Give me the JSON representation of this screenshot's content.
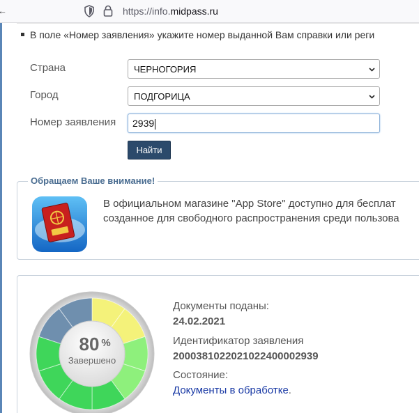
{
  "browser": {
    "back_fragment": "←",
    "url_prefix": "https://info.",
    "url_domain": "midpass.ru",
    "icons": [
      "shield-icon",
      "lock-icon"
    ]
  },
  "instructions": {
    "text": "В поле «Номер заявления» укажите номер выданной Вам справки или реги"
  },
  "form": {
    "country_label": "Страна",
    "country_value": "ЧЕРНОГОРИЯ",
    "city_label": "Город",
    "city_value": "ПОДГОРИЦА",
    "number_label": "Номер заявления",
    "number_value": "2939",
    "search_button": "Найти"
  },
  "notice": {
    "legend": "Обращаем Ваше внимание!",
    "line1": "В официальном магазине \"App Store\" доступно для бесплат",
    "line2": "созданное для свободного распространения среди пользова",
    "icon": "passport-app-icon"
  },
  "status": {
    "progress_percent": 80,
    "percent_value": "80",
    "percent_sign": "%",
    "gauge_caption": "Завершено",
    "submitted_label": "Документы поданы:",
    "submitted_date": "24.02.2021",
    "id_label": "Идентификатор заявления",
    "id_value": "2000381022021022400002939",
    "state_label": "Состояние:",
    "state_value": "Документы в обработке",
    "state_dot": "."
  },
  "colors": {
    "button": "#2c4a6b",
    "link": "#1a3aa5",
    "gauge_done_green": "#3fd65a",
    "gauge_light_green": "#8ef07c",
    "gauge_yellow": "#f4f27a",
    "gauge_pending": "#6f8fae"
  }
}
